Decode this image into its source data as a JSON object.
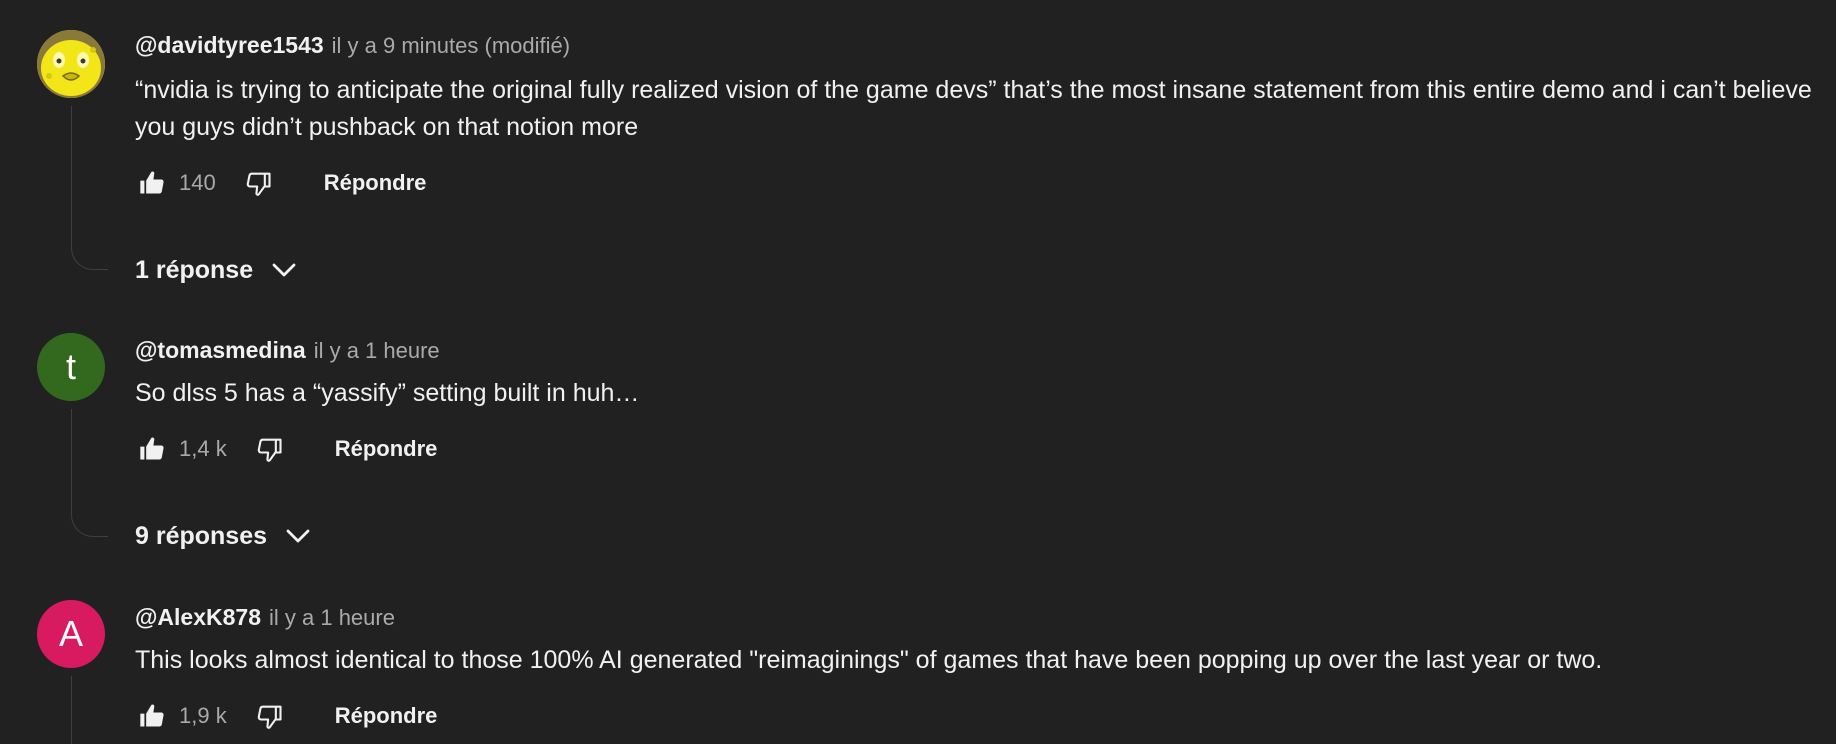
{
  "comments": [
    {
      "author": "@davidtyree1543",
      "time": "il y a 9 minutes (modifié)",
      "text": "“nvidia is trying to anticipate the original fully realized vision of the game devs” that’s the most insane statement from this entire demo and i can’t believe you guys didn’t pushback on that notion more",
      "likes": "140",
      "reply_label": "Répondre",
      "replies_label": "1 réponse",
      "avatar": {
        "type": "image",
        "icon": "yellow-sponge-avatar",
        "color": "#f2e618"
      }
    },
    {
      "author": "@tomasmedina",
      "time": "il y a 1 heure",
      "text": "So dlss 5 has a “yassify” setting built in huh…",
      "likes": "1,4 k",
      "reply_label": "Répondre",
      "replies_label": "9 réponses",
      "avatar": {
        "type": "letter",
        "letter": "t",
        "color": "#33691e"
      }
    },
    {
      "author": "@AlexK878",
      "time": "il y a 1 heure",
      "text": "This looks almost identical to those 100% AI generated \"reimaginings\" of games that have been popping up over the last year or two.",
      "likes": "1,9 k",
      "reply_label": "Répondre",
      "avatar": {
        "type": "letter",
        "letter": "A",
        "color": "#d81b60"
      }
    }
  ],
  "icons": {
    "like": "thumbs-up-icon",
    "dislike": "thumbs-down-icon",
    "expand": "chevron-down-icon"
  }
}
